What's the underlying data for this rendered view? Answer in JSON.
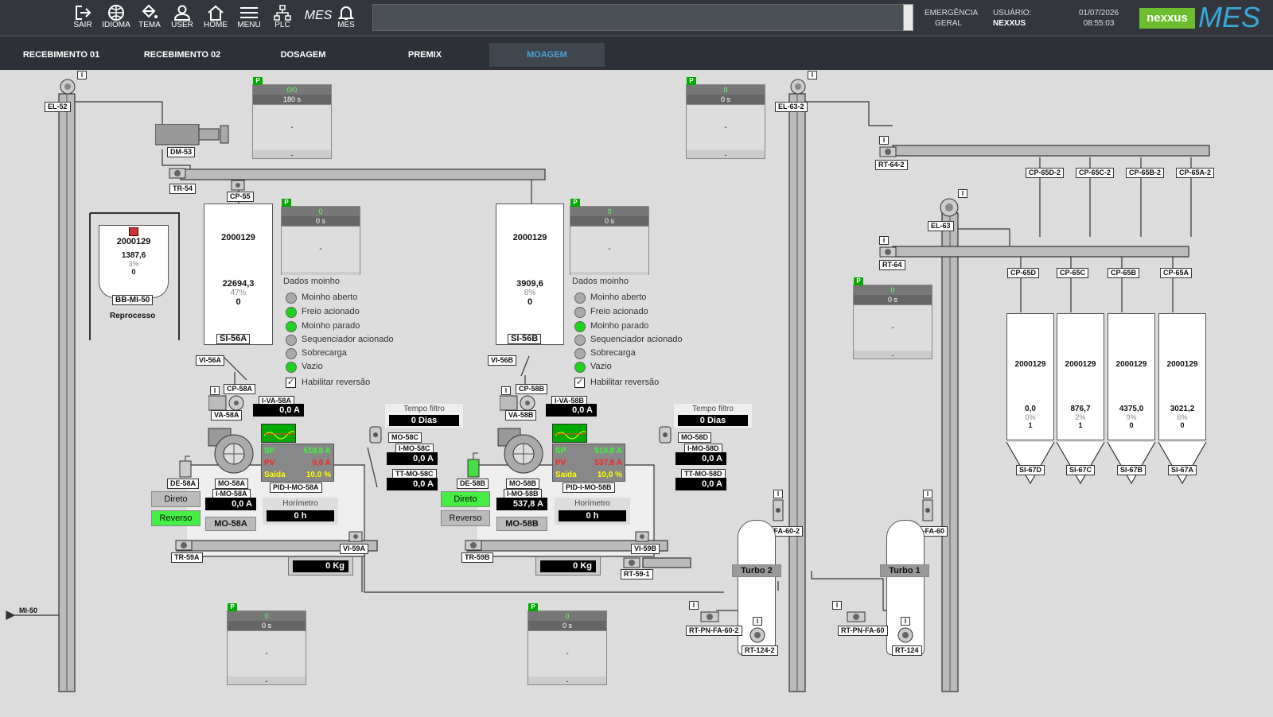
{
  "topbar": {
    "buttons": [
      {
        "label": "SAIR",
        "icon": "exit-icon"
      },
      {
        "label": "IDIOMA",
        "icon": "globe-icon"
      },
      {
        "label": "TEMA",
        "icon": "paint-bucket-icon"
      },
      {
        "label": "USER",
        "icon": "user-icon"
      },
      {
        "label": "HOME",
        "icon": "home-icon"
      },
      {
        "label": "MENU",
        "icon": "menu-icon"
      },
      {
        "label": "PLC",
        "icon": "network-icon"
      },
      {
        "label": "MES",
        "icon": "mes-icon"
      }
    ],
    "emergencia_l1": "EMERGÊNCIA",
    "emergencia_l2": "GERAL",
    "usuario_label": "USUÁRIO:",
    "usuario_value": "NEXXUS",
    "date": "01/07/2026",
    "time": "08:55:03",
    "logo_nexxus": "nexxus",
    "logo_mes": "MES"
  },
  "tabs": [
    {
      "label": "RECEBIMENTO 01",
      "active": false
    },
    {
      "label": "RECEBIMENTO 02",
      "active": false
    },
    {
      "label": "DOSAGEM",
      "active": false
    },
    {
      "label": "PREMIX",
      "active": false
    },
    {
      "label": "MOAGEM",
      "active": true
    }
  ],
  "tags": {
    "el52": "EL-52",
    "dm53": "DM-53",
    "tr54": "TR-54",
    "cp55": "CP-55",
    "bbmi50": "BB-MI-50",
    "reprocesso": "Reprocesso",
    "si56a": "SI-56A",
    "vi56a": "VI-56A",
    "cp58a": "CP-58A",
    "iva58a": "I-VA-58A",
    "va58a": "VA-58A",
    "de58a": "DE-58A",
    "mo58a": "MO-58A",
    "pid58a": "PID-I-MO-58A",
    "imo58a": "I-MO-58A",
    "mo58a_btn": "MO-58A",
    "mo58c": "MO-58C",
    "imo58c": "I-MO-58C",
    "ttmo58c": "TT-MO-58C",
    "tr59a": "TR-59A",
    "vi59a": "VI-59A",
    "si56b": "SI-56B",
    "vi56b": "VI-56B",
    "cp58b": "CP-58B",
    "iva58b": "I-VA-58B",
    "va58b": "VA-58B",
    "de58b": "DE-58B",
    "mo58b": "MO-58B",
    "pid58b": "PID-I-MO-58B",
    "imo58b": "I-MO-58B",
    "mo58b_btn": "MO-58B",
    "mo58d": "MO-58D",
    "imo58d": "I-MO-58D",
    "ttmo58d": "TT-MO-58D",
    "tr59b": "TR-59B",
    "vi59b": "VI-59B",
    "rt591": "RT-59-1",
    "el632": "EL-63-2",
    "rt642": "RT-64-2",
    "cp65d2": "CP-65D-2",
    "cp65c2": "CP-65C-2",
    "cp65b2": "CP-65B-2",
    "cp65a2": "CP-65A-2",
    "el63": "EL-63",
    "rt64": "RT-64",
    "cp65d": "CP-65D",
    "cp65c": "CP-65C",
    "cp65b": "CP-65B",
    "cp65a": "CP-65A",
    "si67d": "SI-67D",
    "si67c": "SI-67C",
    "si67b": "SI-67B",
    "si67a": "SI-67A",
    "pnfa602": "PN-FA-60-2",
    "turbo2": "Turbo 2",
    "rtpnfa602": "RT-PN-FA-60-2",
    "rt1242": "RT-124-2",
    "pnfa60": "PN-FA-60",
    "turbo1": "Turbo 1",
    "rtpnfa60": "RT-PN-FA-60",
    "rt124": "RT-124",
    "mi50": "MI-50"
  },
  "pidboxes": [
    {
      "id": "p1",
      "r1": "0/0",
      "r2": "180 s",
      "r3": "-",
      "r4": "-"
    },
    {
      "id": "p2",
      "r1": "0",
      "r2": "0 s",
      "r3": "-",
      "r4": "-"
    },
    {
      "id": "p3",
      "r1": "0",
      "r2": "0 s",
      "r3": "-",
      "r4": "-"
    },
    {
      "id": "p4",
      "r1": "0",
      "r2": "0 s",
      "r3": "-",
      "r4": "-"
    },
    {
      "id": "p5",
      "r1": "0",
      "r2": "0 s",
      "r3": "-",
      "r4": "-"
    },
    {
      "id": "p6",
      "r1": "0",
      "r2": "0 s",
      "r3": "-",
      "r4": "-"
    },
    {
      "id": "p7",
      "r1": "0",
      "r2": "0 s",
      "r3": "-",
      "r4": "-"
    }
  ],
  "bigbag": {
    "lot": "2000129",
    "qty": "1387,6",
    "pct": "3%",
    "n": "0"
  },
  "si56a": {
    "lot": "2000129",
    "qty": "22694,3",
    "pct": "47%",
    "n": "0"
  },
  "si56b": {
    "lot": "2000129",
    "qty": "3909,6",
    "pct": "8%",
    "n": "0"
  },
  "moinhoA": {
    "title": "Dados moinho",
    "items": [
      {
        "label": "Moinho aberto",
        "on": false
      },
      {
        "label": "Freio acionado",
        "on": true
      },
      {
        "label": "Moinho parado",
        "on": true
      },
      {
        "label": "Sequenciador acionado",
        "on": false
      },
      {
        "label": "Sobrecarga",
        "on": false
      },
      {
        "label": "Vazio",
        "on": true
      }
    ],
    "reversao": "Habilitar reversão",
    "iva": "0,0 A",
    "tempo_label": "Tempo filtro",
    "tempo_value": "0 Dias",
    "sp_label": "SP",
    "sp": "510,0 A",
    "pv_label": "PV",
    "pv": "0,0 A",
    "saida_label": "Saída",
    "saida": "10,0 %",
    "imo": "0,0 A",
    "imoc": "0,0 A",
    "ttmo": "0,0 A",
    "direto": "Direto",
    "reverso": "Reverso",
    "horimetro_label": "Horímetro",
    "horimetro": "0 h",
    "kg": "0 Kg"
  },
  "moinhoB": {
    "title": "Dados moinho",
    "items": [
      {
        "label": "Moinho aberto",
        "on": false
      },
      {
        "label": "Freio acionado",
        "on": false
      },
      {
        "label": "Moinho parado",
        "on": true
      },
      {
        "label": "Sequenciador acionado",
        "on": false
      },
      {
        "label": "Sobrecarga",
        "on": false
      },
      {
        "label": "Vazio",
        "on": true
      }
    ],
    "reversao": "Habilitar reversão",
    "iva": "0,0 A",
    "tempo_label": "Tempo filtro",
    "tempo_value": "0 Dias",
    "sp_label": "SP",
    "sp": "510,0 A",
    "pv_label": "PV",
    "pv": "537,8 A",
    "saida_label": "Saída",
    "saida": "10,0 %",
    "imo": "537,8 A",
    "imoc": "0,0 A",
    "ttmo": "0,0 A",
    "direto": "Direto",
    "reverso": "Reverso",
    "horimetro_label": "Horímetro",
    "horimetro": "0 h",
    "kg": "0 Kg"
  },
  "bins": [
    {
      "lot": "2000129",
      "qty": "0,0",
      "pct": "0%",
      "n": "1"
    },
    {
      "lot": "2000129",
      "qty": "876,7",
      "pct": "2%",
      "n": "1"
    },
    {
      "lot": "2000129",
      "qty": "4375,0",
      "pct": "9%",
      "n": "0"
    },
    {
      "lot": "2000129",
      "qty": "3021,2",
      "pct": "6%",
      "n": "0"
    }
  ],
  "badges": {
    "i": "I",
    "p": "P"
  },
  "colors": {
    "active_tab_text": "#4aa3d6",
    "green_lamp": "#1fd21f",
    "nexxus_green": "#6cbe2e"
  }
}
